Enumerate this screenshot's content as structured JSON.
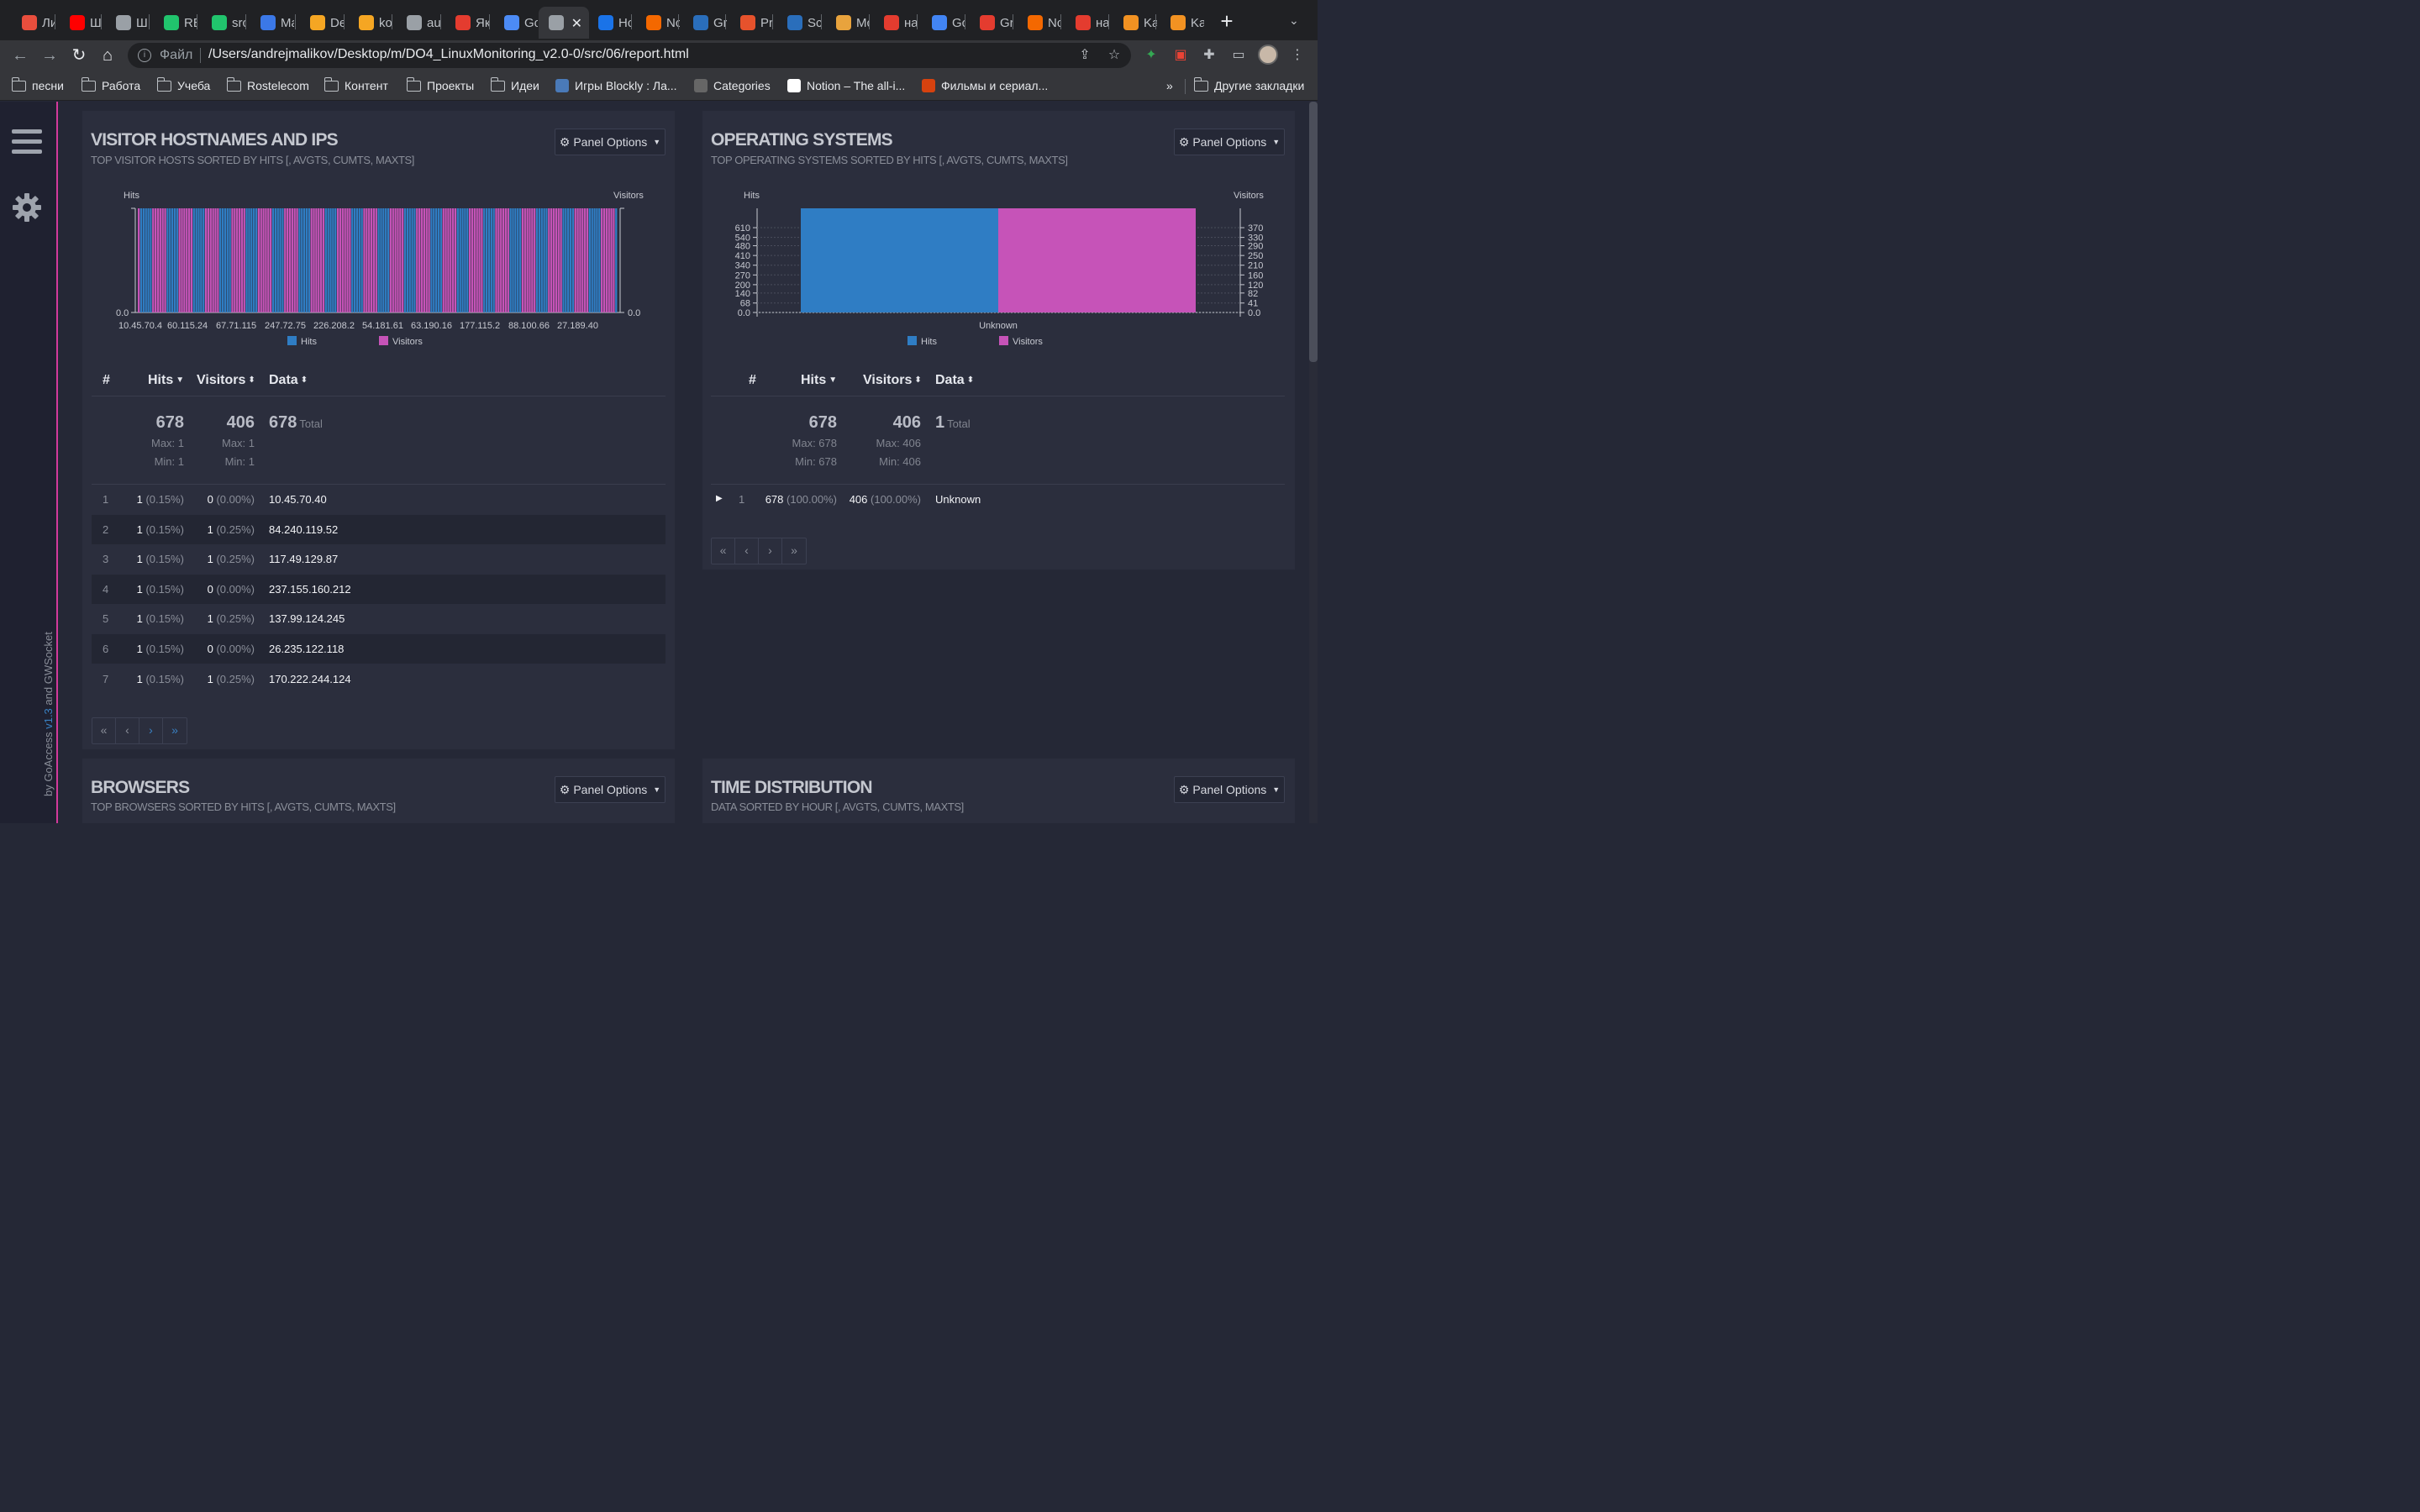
{
  "browser": {
    "tabs": [
      {
        "label": "Ли",
        "icon": "bookmark-favicon",
        "color": "#e94e3d"
      },
      {
        "label": "Ш",
        "icon": "youtube-icon",
        "color": "#ff0000"
      },
      {
        "label": "Ш",
        "icon": "globe-icon",
        "color": "#9aa0a6"
      },
      {
        "label": "RE",
        "icon": "s21-icon",
        "color": "#21c46d"
      },
      {
        "label": "src",
        "icon": "s21-icon",
        "color": "#21c46d"
      },
      {
        "label": "Ma",
        "icon": "mail-icon",
        "color": "#3b78e7"
      },
      {
        "label": "De",
        "icon": "cloud-icon",
        "color": "#f5a623"
      },
      {
        "label": "ko",
        "icon": "cloud-icon",
        "color": "#f5a623"
      },
      {
        "label": "au",
        "icon": "globe-icon",
        "color": "#9aa0a6"
      },
      {
        "label": "Як",
        "icon": "yandex-icon",
        "color": "#e43c2f"
      },
      {
        "label": "Go",
        "icon": "goaccess-icon",
        "color": "#4c8bf5"
      },
      {
        "label": "",
        "icon": "globe-icon",
        "color": "#9aa0a6"
      },
      {
        "label": "Hc",
        "icon": "app-icon",
        "color": "#1a73e8"
      },
      {
        "label": "Nc",
        "icon": "grafana-icon",
        "color": "#f46800"
      },
      {
        "label": "Gr",
        "icon": "r-icon",
        "color": "#2a6ebb"
      },
      {
        "label": "Pr",
        "icon": "prometheus-icon",
        "color": "#e6522c"
      },
      {
        "label": "Sc",
        "icon": "r-icon",
        "color": "#2a6ebb"
      },
      {
        "label": "Mc",
        "icon": "bird-icon",
        "color": "#e8a33d"
      },
      {
        "label": "на",
        "icon": "yandex-icon",
        "color": "#e43c2f"
      },
      {
        "label": "Gc",
        "icon": "translate-icon",
        "color": "#4285f4"
      },
      {
        "label": "Gr",
        "icon": "yandex-icon",
        "color": "#e43c2f"
      },
      {
        "label": "Nc",
        "icon": "grafana-icon",
        "color": "#f46800"
      },
      {
        "label": "на",
        "icon": "yandex-icon",
        "color": "#e43c2f"
      },
      {
        "label": "Ka",
        "icon": "it-icon",
        "color": "#f29222"
      },
      {
        "label": "Ka",
        "icon": "it-icon",
        "color": "#f29222"
      }
    ],
    "file_label": "Файл",
    "url": "/Users/andrejmalikov/Desktop/m/DO4_LinuxMonitoring_v2.0-0/src/06/report.html",
    "bookmarks": [
      {
        "label": "песни",
        "type": "folder"
      },
      {
        "label": "Работа",
        "type": "folder"
      },
      {
        "label": "Учеба",
        "type": "folder"
      },
      {
        "label": "Rostelecom",
        "type": "folder"
      },
      {
        "label": "Контент",
        "type": "folder"
      },
      {
        "label": "Проекты",
        "type": "folder"
      },
      {
        "label": "Идеи",
        "type": "folder"
      },
      {
        "label": "Игры Blockly : Ла...",
        "type": "site"
      },
      {
        "label": "Categories",
        "type": "site"
      },
      {
        "label": "Notion – The all-i...",
        "type": "site"
      },
      {
        "label": "Фильмы и сериал...",
        "type": "site"
      }
    ],
    "bookmarks_overflow": "»",
    "other_bookmarks": "Другие закладки"
  },
  "sidebar": {
    "credit_by": "by GoAccess",
    "credit_version": "v1.3",
    "credit_and": "and GWSocket"
  },
  "panel_options_label": "Panel Options",
  "visitors_panel": {
    "title": "VISITOR HOSTNAMES AND IPS",
    "subtitle": "TOP VISITOR HOSTS SORTED BY HITS [, AVGTS, CUMTS, MAXTS]",
    "headers": {
      "num": "#",
      "hits": "Hits",
      "visitors": "Visitors",
      "data": "Data"
    },
    "totals": {
      "hits": "678",
      "visitors": "406",
      "data": "678",
      "data_label": "Total",
      "hits_max": "Max: 1",
      "hits_min": "Min: 1",
      "visitors_max": "Max: 1",
      "visitors_min": "Min: 1"
    },
    "rows": [
      {
        "n": "1",
        "hits": "1",
        "hits_pct": "(0.15%)",
        "visitors": "0",
        "visitors_pct": "(0.00%)",
        "data": "10.45.70.40"
      },
      {
        "n": "2",
        "hits": "1",
        "hits_pct": "(0.15%)",
        "visitors": "1",
        "visitors_pct": "(0.25%)",
        "data": "84.240.119.52"
      },
      {
        "n": "3",
        "hits": "1",
        "hits_pct": "(0.15%)",
        "visitors": "1",
        "visitors_pct": "(0.25%)",
        "data": "117.49.129.87"
      },
      {
        "n": "4",
        "hits": "1",
        "hits_pct": "(0.15%)",
        "visitors": "0",
        "visitors_pct": "(0.00%)",
        "data": "237.155.160.212"
      },
      {
        "n": "5",
        "hits": "1",
        "hits_pct": "(0.15%)",
        "visitors": "1",
        "visitors_pct": "(0.25%)",
        "data": "137.99.124.245"
      },
      {
        "n": "6",
        "hits": "1",
        "hits_pct": "(0.15%)",
        "visitors": "0",
        "visitors_pct": "(0.00%)",
        "data": "26.235.122.118"
      },
      {
        "n": "7",
        "hits": "1",
        "hits_pct": "(0.15%)",
        "visitors": "1",
        "visitors_pct": "(0.25%)",
        "data": "170.222.244.124"
      }
    ],
    "pager": [
      "«",
      "‹",
      "›",
      "»"
    ]
  },
  "os_panel": {
    "title": "OPERATING SYSTEMS",
    "subtitle": "TOP OPERATING SYSTEMS SORTED BY HITS [, AVGTS, CUMTS, MAXTS]",
    "headers": {
      "num": "#",
      "hits": "Hits",
      "visitors": "Visitors",
      "data": "Data"
    },
    "totals": {
      "hits": "678",
      "visitors": "406",
      "data": "1",
      "data_label": "Total",
      "hits_max": "Max: 678",
      "hits_min": "Min: 678",
      "visitors_max": "Max: 406",
      "visitors_min": "Min: 406"
    },
    "rows": [
      {
        "n": "1",
        "hits": "678",
        "hits_pct": "(100.00%)",
        "visitors": "406",
        "visitors_pct": "(100.00%)",
        "data": "Unknown"
      }
    ],
    "pager": [
      "«",
      "‹",
      "›",
      "»"
    ]
  },
  "browsers_panel": {
    "title": "BROWSERS",
    "subtitle": "TOP BROWSERS SORTED BY HITS [, AVGTS, CUMTS, MAXTS]"
  },
  "time_panel": {
    "title": "TIME DISTRIBUTION",
    "subtitle": "DATA SORTED BY HOUR [, AVGTS, CUMTS, MAXTS]"
  },
  "colors": {
    "hits": "#2f7dc4",
    "visitors": "#c653b8"
  },
  "chart_data": [
    {
      "type": "bar",
      "title": "",
      "ylabel": "Hits",
      "y2label": "Visitors",
      "y_ticks": [
        "0.0"
      ],
      "y2_ticks": [
        "0.0"
      ],
      "categories": [
        "10.45.70.4",
        "60.115.24",
        "67.71.115",
        "247.72.75",
        "226.208.2",
        "54.181.61",
        "63.190.16",
        "177.115.2",
        "88.100.66",
        "27.189.40"
      ],
      "series": [
        {
          "name": "Hits",
          "color": "#2f7dc4",
          "values": [
            1,
            1,
            1,
            1,
            1,
            1,
            1,
            1,
            1,
            1
          ]
        },
        {
          "name": "Visitors",
          "color": "#c653b8",
          "values": [
            0,
            1,
            1,
            0,
            1,
            0,
            1,
            1,
            0,
            1
          ]
        }
      ],
      "legend": "bottom",
      "grid": false
    },
    {
      "type": "bar",
      "title": "",
      "ylabel": "Hits",
      "y2label": "Visitors",
      "categories": [
        "Unknown"
      ],
      "y_ticks": [
        "0.0",
        "68",
        "140",
        "200",
        "270",
        "340",
        "410",
        "480",
        "540",
        "610"
      ],
      "y2_ticks": [
        "0.0",
        "41",
        "82",
        "120",
        "160",
        "210",
        "250",
        "290",
        "330",
        "370"
      ],
      "ylim": [
        0,
        678
      ],
      "y2lim": [
        0,
        406
      ],
      "series": [
        {
          "name": "Hits",
          "color": "#2f7dc4",
          "values": [
            678
          ]
        },
        {
          "name": "Visitors",
          "color": "#c653b8",
          "values": [
            406
          ]
        }
      ],
      "legend": "bottom",
      "grid": true
    }
  ]
}
